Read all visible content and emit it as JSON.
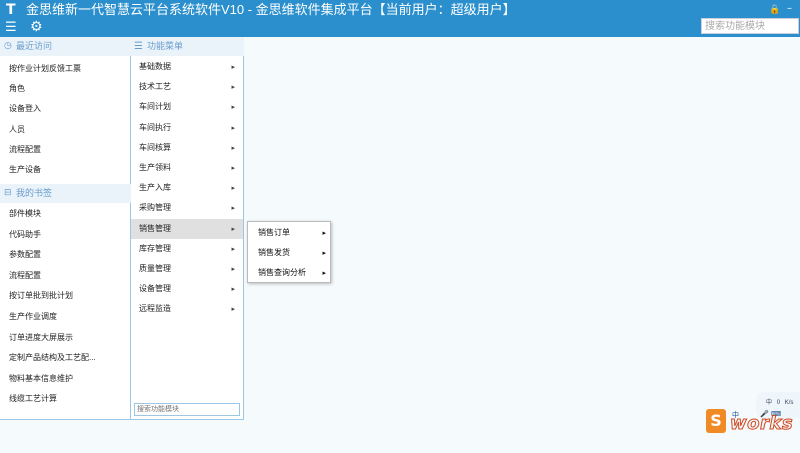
{
  "header": {
    "logo": "T",
    "title": "金思维新一代智慧云平台系统软件V10 - 金思维软件集成平台【当前用户：超级用户】",
    "search_placeholder": "搜索功能模块"
  },
  "recent": {
    "title": "最近访问",
    "items": [
      "按作业计划反馈工票",
      "角色",
      "设备登入",
      "人员",
      "流程配置",
      "生产设备"
    ]
  },
  "bookmarks": {
    "title": "我的书签",
    "items": [
      "部件模块",
      "代码助手",
      "参数配置",
      "流程配置",
      "按订单批到批计划",
      "生产作业调度",
      "订单进度大屏展示",
      "定制产品结构及工艺配...",
      "物料基本信息维护",
      "线缆工艺计算"
    ]
  },
  "function_menu": {
    "title": "功能菜单",
    "items": [
      "基础数据",
      "技术工艺",
      "车间计划",
      "车间执行",
      "车间核算",
      "生产领料",
      "生产入库",
      "采购管理",
      "销售管理",
      "库存管理",
      "质量管理",
      "设备管理",
      "远程监造"
    ],
    "active_index": 8,
    "search_placeholder": "搜索功能模块"
  },
  "submenu": {
    "items": [
      "销售订单",
      "销售发货",
      "销售查询分析"
    ]
  },
  "tray": {
    "items": [
      "中",
      "0",
      "K/s"
    ]
  },
  "watermark": {
    "brand": "works",
    "letter": "S",
    "zh": "中",
    "icons": "🎤 ⌨"
  },
  "icons": {
    "menu": "☰",
    "gear": "⚙",
    "user": "🔒",
    "minimize": "–",
    "clock": "◷",
    "bookmark": "⊟",
    "list": "☰",
    "chevron": "▸"
  },
  "colors": {
    "topbar": "#2a8fcc",
    "accent_text": "#6a9ccc",
    "active_row": "#e0e0e0"
  }
}
